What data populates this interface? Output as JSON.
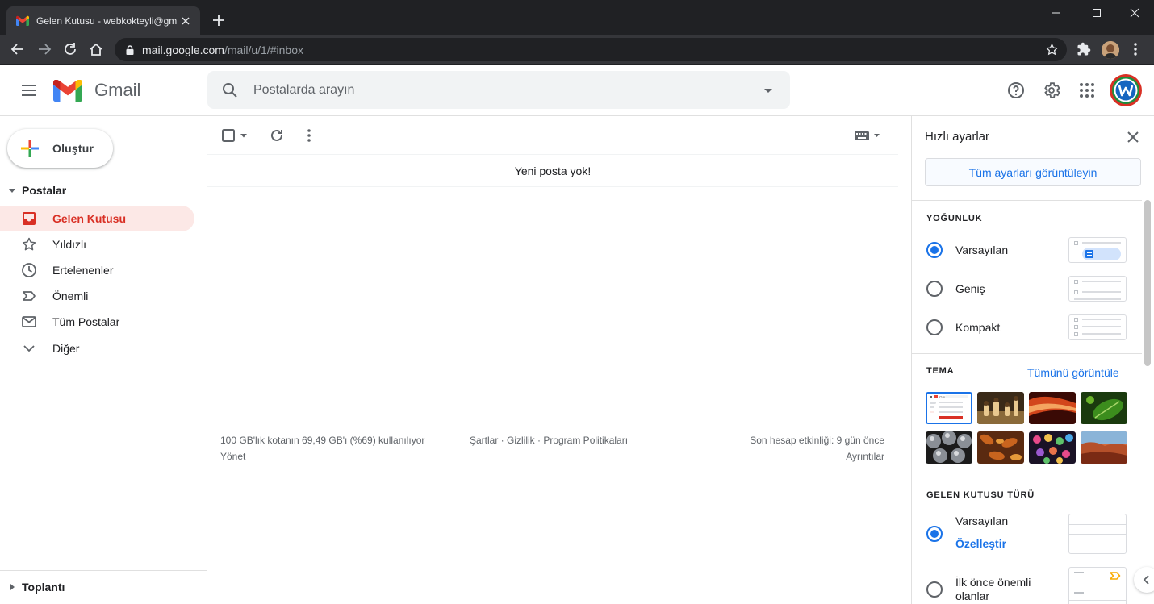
{
  "browser": {
    "tab_title": "Gelen Kutusu - webkokteyli@gm",
    "url_host": "mail.google.com",
    "url_path": "/mail/u/1/#inbox"
  },
  "header": {
    "app_name": "Gmail",
    "search_placeholder": "Postalarda arayın"
  },
  "sidebar": {
    "compose_label": "Oluştur",
    "section_mail": "Postalar",
    "items": [
      {
        "label": "Gelen Kutusu",
        "icon": "inbox-icon",
        "active": true
      },
      {
        "label": "Yıldızlı",
        "icon": "star-icon"
      },
      {
        "label": "Ertelenenler",
        "icon": "clock-icon"
      },
      {
        "label": "Önemli",
        "icon": "label-important-icon"
      },
      {
        "label": "Tüm Postalar",
        "icon": "mail-icon"
      },
      {
        "label": "Diğer",
        "icon": "chevron-down-icon"
      }
    ],
    "section_meet": "Toplantı"
  },
  "main": {
    "empty_message": "Yeni posta yok!",
    "storage_text": "100 GB'lık kotanın 69,49 GB'ı (%69) kullanılıyor",
    "manage_link": "Yönet",
    "policy_links": "Şartlar · Gizlilik · Program Politikaları",
    "last_activity": "Son hesap etkinliği: 9 gün önce",
    "details_link": "Ayrıntılar"
  },
  "quick_settings": {
    "title": "Hızlı ayarlar",
    "all_settings_button": "Tüm ayarları görüntüleyin",
    "density_label": "YOĞUNLUK",
    "density_options": [
      "Varsayılan",
      "Geniş",
      "Kompakt"
    ],
    "density_selected": "Varsayılan",
    "theme_label": "TEMA",
    "theme_view_all": "Tümünü görüntüle",
    "inbox_type_label": "GELEN KUTUSU TÜRÜ",
    "inbox_default": "Varsayılan",
    "inbox_customize": "Özelleştir",
    "inbox_important_first": "İlk önce önemli olanlar",
    "thumb_mini_logo": "Gmail"
  },
  "colors": {
    "accent_blue": "#1a73e8",
    "active_red": "#d93025",
    "active_bg": "#fce8e6"
  }
}
